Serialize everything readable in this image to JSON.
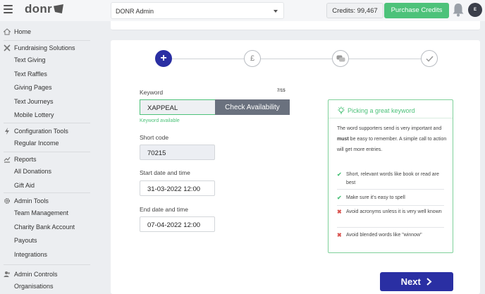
{
  "header": {
    "logo_text": "donr",
    "org_name": "DONR Admin",
    "credits_label": "Credits: 99,467",
    "purchase_label": "Purchase Credits",
    "avatar_initial": "E"
  },
  "sidebar": {
    "home": "Home",
    "fundraising": {
      "title": "Fundraising Solutions",
      "items": [
        "Text Giving",
        "Text Raffles",
        "Giving Pages",
        "Text Journeys",
        "Mobile Lottery"
      ]
    },
    "config": {
      "title": "Configuration Tools",
      "items": [
        "Regular Income"
      ]
    },
    "reports": {
      "title": "Reports",
      "items": [
        "All Donations",
        "Gift Aid"
      ]
    },
    "admin_tools": {
      "title": "Admin Tools",
      "items": [
        "Team Management",
        "Charity Bank Account",
        "Payouts",
        "Integrations"
      ]
    },
    "admin_controls": {
      "title": "Admin Controls",
      "items": [
        "Organisations"
      ]
    }
  },
  "steps": {
    "step1": "+",
    "step2": "£"
  },
  "form": {
    "keyword_label": "Keyword",
    "keyword_count": "7/15",
    "keyword_value": "XAPPEAL",
    "check_label": "Check Availability",
    "keyword_status": "Keyword available",
    "shortcode_label": "Short code",
    "shortcode_value": "70215",
    "start_label": "Start date and time",
    "start_value": "31-03-2022 12:00",
    "end_label": "End date and time",
    "end_value": "07-04-2022 12:00"
  },
  "tip": {
    "title": "Picking a great keyword",
    "intro_pre": "The word supporters send is very important and ",
    "intro_bold": "must",
    "intro_post": " be easy to remember. A simple call to action will get more entries.",
    "rows": [
      {
        "mark": "✔",
        "text": "Short, relevant words like book or read are best"
      },
      {
        "mark": "✔",
        "text": "Make sure it's easy to spell"
      },
      {
        "mark": "✖",
        "text": "Avoid acronyms unless it is very well known"
      },
      {
        "mark": "✖",
        "text": "Avoid blended words like \"winnow\""
      }
    ]
  },
  "next_label": "Next",
  "colors": {
    "primary": "#2a2fa3",
    "success": "#4dc27a",
    "danger": "#d9534f"
  }
}
